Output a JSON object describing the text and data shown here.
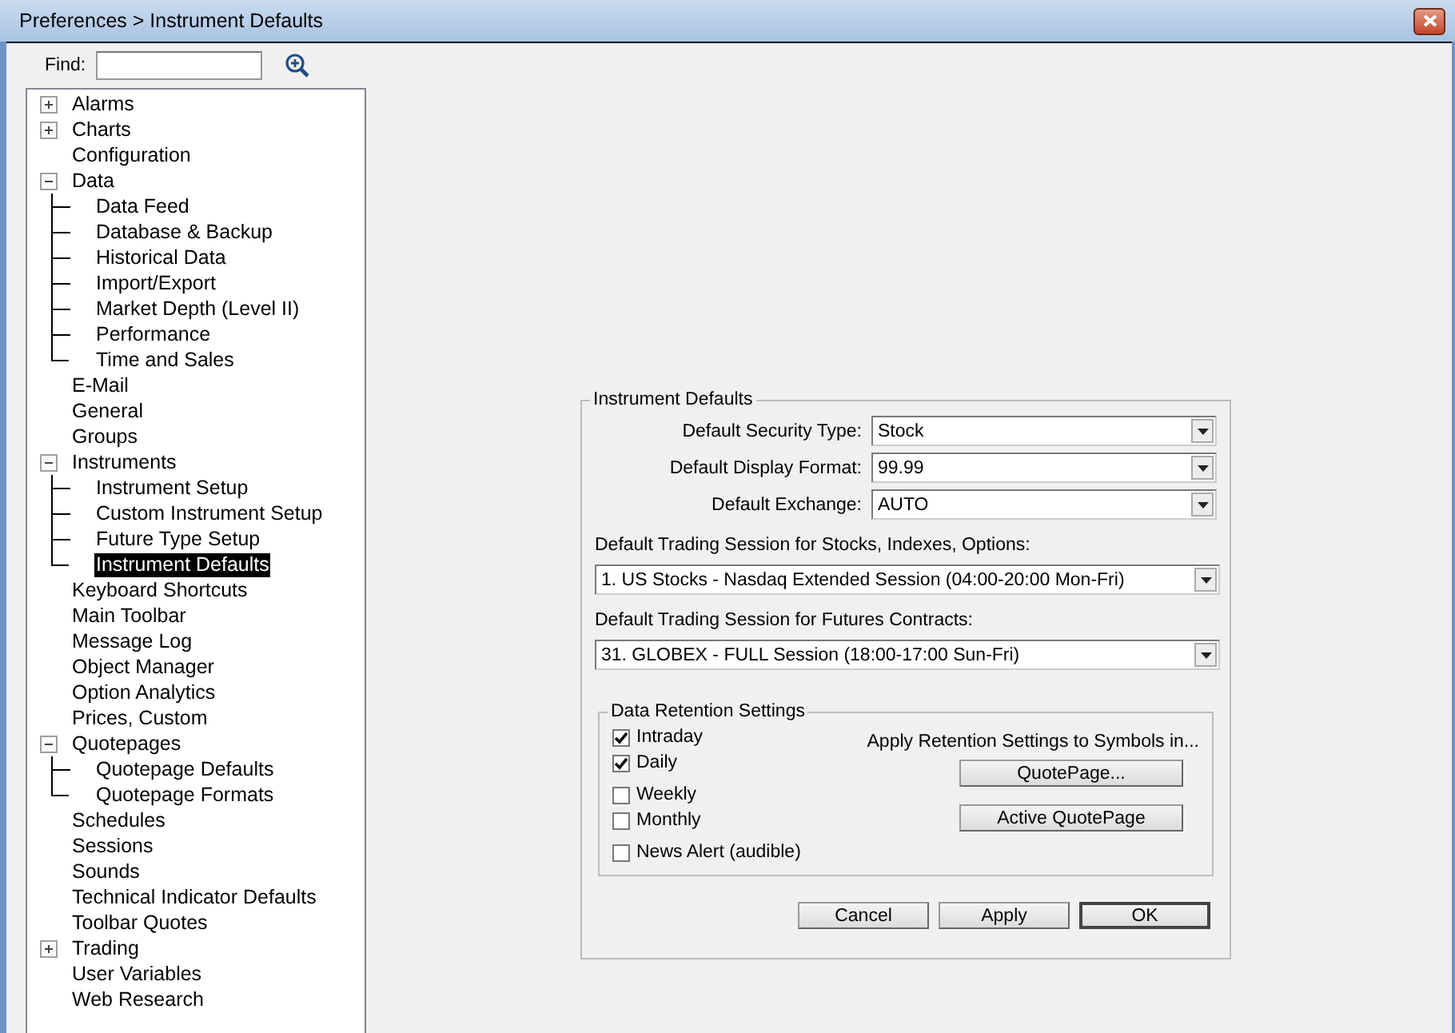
{
  "window": {
    "title": "Preferences > Instrument Defaults"
  },
  "find": {
    "label": "Find:"
  },
  "tree": [
    {
      "label": "Alarms",
      "expanded": false,
      "selected": false
    },
    {
      "label": "Charts",
      "expanded": false,
      "selected": false
    },
    {
      "label": "Configuration",
      "selected": false
    },
    {
      "label": "Data",
      "expanded": true,
      "selected": false,
      "children": [
        {
          "label": "Data Feed",
          "selected": false
        },
        {
          "label": "Database & Backup",
          "selected": false
        },
        {
          "label": "Historical Data",
          "selected": false
        },
        {
          "label": "Import/Export",
          "selected": false
        },
        {
          "label": "Market Depth (Level II)",
          "selected": false
        },
        {
          "label": "Performance",
          "selected": false
        },
        {
          "label": "Time and Sales",
          "selected": false
        }
      ]
    },
    {
      "label": "E-Mail",
      "selected": false
    },
    {
      "label": "General",
      "selected": false
    },
    {
      "label": "Groups",
      "selected": false
    },
    {
      "label": "Instruments",
      "expanded": true,
      "selected": false,
      "children": [
        {
          "label": "Instrument Setup",
          "selected": false
        },
        {
          "label": "Custom Instrument Setup",
          "selected": false
        },
        {
          "label": "Future Type Setup",
          "selected": false
        },
        {
          "label": "Instrument Defaults",
          "selected": true
        }
      ]
    },
    {
      "label": "Keyboard Shortcuts",
      "selected": false
    },
    {
      "label": "Main Toolbar",
      "selected": false
    },
    {
      "label": "Message Log",
      "selected": false
    },
    {
      "label": "Object Manager",
      "selected": false
    },
    {
      "label": "Option Analytics",
      "selected": false
    },
    {
      "label": "Prices, Custom",
      "selected": false
    },
    {
      "label": "Quotepages",
      "expanded": true,
      "selected": false,
      "children": [
        {
          "label": "Quotepage Defaults",
          "selected": false
        },
        {
          "label": "Quotepage Formats",
          "selected": false
        }
      ]
    },
    {
      "label": "Schedules",
      "selected": false
    },
    {
      "label": "Sessions",
      "selected": false
    },
    {
      "label": "Sounds",
      "selected": false
    },
    {
      "label": "Technical Indicator Defaults",
      "selected": false
    },
    {
      "label": "Toolbar Quotes",
      "selected": false
    },
    {
      "label": "Trading",
      "expanded": false,
      "selected": false
    },
    {
      "label": "User Variables",
      "selected": false
    },
    {
      "label": "Web Research",
      "selected": false
    }
  ],
  "group": {
    "title": "Instrument Defaults",
    "fields": [
      {
        "label": "Default Security Type:",
        "value": "Stock"
      },
      {
        "label": "Default Display Format:",
        "value": "99.99"
      },
      {
        "label": "Default Exchange:",
        "value": "AUTO"
      }
    ],
    "sessions": [
      {
        "label": "Default Trading Session for Stocks, Indexes, Options:",
        "value": "1. US Stocks - Nasdaq Extended Session (04:00-20:00 Mon-Fri)"
      },
      {
        "label": "Default Trading Session for Futures Contracts:",
        "value": "31. GLOBEX - FULL Session (18:00-17:00 Sun-Fri)"
      }
    ],
    "retention": {
      "title": "Data Retention Settings",
      "checkboxes": [
        {
          "label": "Intraday",
          "checked": true
        },
        {
          "label": "Daily",
          "checked": true
        },
        {
          "label": "Weekly",
          "checked": false
        },
        {
          "label": "Monthly",
          "checked": false
        },
        {
          "label": "News Alert (audible)",
          "checked": false
        }
      ],
      "apply_label": "Apply Retention Settings to Symbols in...",
      "buttons": [
        "QuotePage...",
        "Active QuotePage"
      ]
    },
    "buttons": [
      {
        "label": "Cancel",
        "default": false
      },
      {
        "label": "Apply",
        "default": false
      },
      {
        "label": "OK",
        "default": true
      }
    ]
  }
}
